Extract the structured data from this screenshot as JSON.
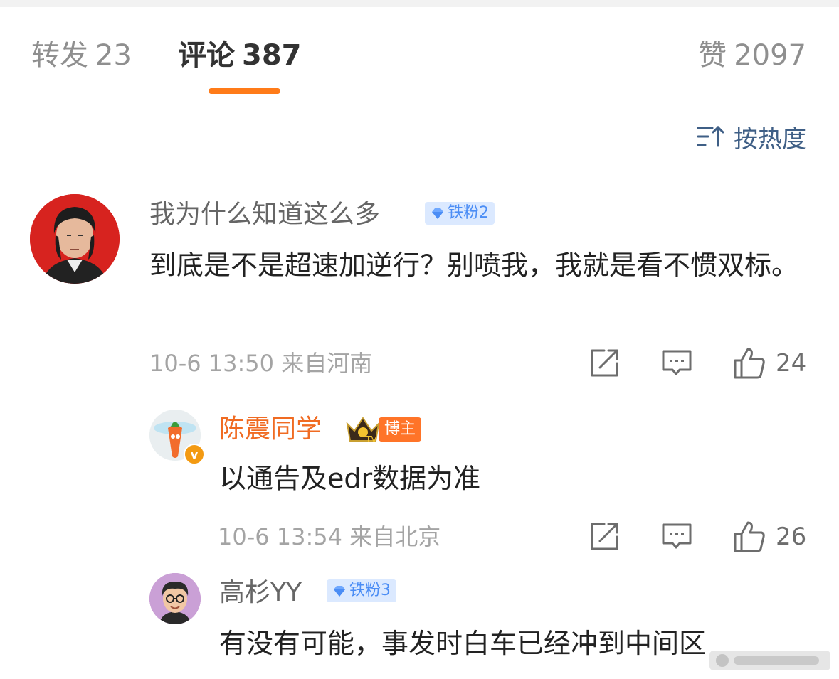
{
  "tabs": {
    "repost": {
      "label": "转发",
      "count": "23"
    },
    "comments": {
      "label": "评论",
      "count": "387"
    },
    "likes": {
      "label": "赞",
      "count": "2097"
    }
  },
  "sort": {
    "label": "按热度"
  },
  "comments": [
    {
      "user": "我为什么知道这么多",
      "badge": "铁粉2",
      "text": "到底是不是超速加逆行？别喷我，我就是看不惯双标。",
      "meta": "10-6 13:50 来自河南",
      "likes": "24"
    },
    {
      "user": "陈震同学",
      "badge": "博主",
      "verified": "v",
      "text": "以通告及edr数据为准",
      "meta": "10-6 13:54 来自北京",
      "likes": "26"
    },
    {
      "user": "高杉YY",
      "badge": "铁粉3",
      "text": "有没有可能，事发时白车已经冲到中间区"
    }
  ],
  "colors": {
    "accent": "#ff7b19",
    "link": "#3f5f86",
    "blogger": "#f06b22"
  }
}
